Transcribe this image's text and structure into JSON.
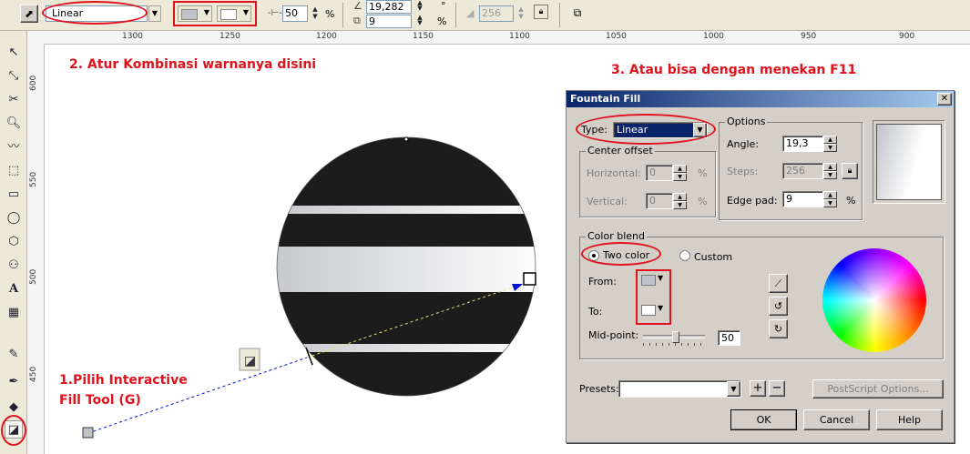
{
  "toolbar": {
    "fill_type": "Linear",
    "midpoint_value": "50",
    "percent": "%",
    "angle_value": "19,282",
    "angle_unit": "°",
    "edge_pad_value": "9",
    "edge_pad_unit": "%",
    "steps_value": "256"
  },
  "ruler_top": [
    "1300",
    "1250",
    "1200",
    "1150",
    "1100",
    "1050",
    "1000",
    "950",
    "900"
  ],
  "ruler_left": [
    "600",
    "550",
    "500",
    "450"
  ],
  "annotations": {
    "step1_line1": "1.Pilih Interactive",
    "step1_line2": "Fill Tool (G)",
    "step2": "2. Atur Kombinasi warnanya disini",
    "step3": "3. Atau bisa dengan menekan F11"
  },
  "dialog": {
    "title": "Fountain Fill",
    "close": "✕",
    "type_label": "Type:",
    "type_value": "Linear",
    "center_offset_label": "Center offset",
    "horizontal_label": "Horizontal:",
    "horizontal_value": "0",
    "vertical_label": "Vertical:",
    "vertical_value": "0",
    "pct": "%",
    "options_label": "Options",
    "angle_label": "Angle:",
    "angle_value": "19,3",
    "steps_label": "Steps:",
    "steps_value": "256",
    "edge_pad_label": "Edge pad:",
    "edge_pad_value": "9",
    "color_blend_label": "Color blend",
    "two_color_label": "Two color",
    "custom_label": "Custom",
    "from_label": "From:",
    "to_label": "To:",
    "midpoint_label": "Mid-point:",
    "midpoint_value": "50",
    "presets_label": "Presets:",
    "presets_value": "",
    "postscript_label": "PostScript Options...",
    "ok_label": "OK",
    "cancel_label": "Cancel",
    "help_label": "Help"
  },
  "colors": {
    "annotation_red": "#e0121b",
    "title_bar": "#0a246a",
    "dark_stripe": "#1c1c1c",
    "from_color": "#c0c3c8",
    "to_color": "#ffffff"
  }
}
